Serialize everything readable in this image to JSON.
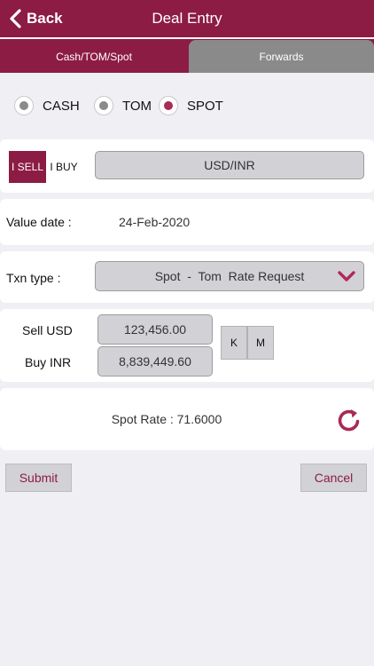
{
  "navbar": {
    "back_label": "Back",
    "title": "Deal Entry"
  },
  "tabs": {
    "cash_tom_spot": "Cash/TOM/Spot",
    "forwards": "Forwards"
  },
  "settlement": {
    "options": [
      {
        "label": "CASH",
        "selected": false
      },
      {
        "label": "TOM",
        "selected": false
      },
      {
        "label": "SPOT",
        "selected": true
      }
    ]
  },
  "deal": {
    "sell_label": "I SELL",
    "buy_label": "I BUY",
    "currency_pair": "USD/INR"
  },
  "value_date": {
    "label": "Value date :",
    "value": "24-Feb-2020"
  },
  "txn_type": {
    "label": "Txn type :",
    "value": "Spot  -  Tom  Rate Request"
  },
  "amounts": {
    "sell_label": "Sell USD",
    "sell_value": "123,456.00",
    "buy_label": "Buy INR",
    "buy_value": "8,839,449.60",
    "k_label": "K",
    "m_label": "M"
  },
  "rate": {
    "text": "Spot Rate : 71.6000"
  },
  "actions": {
    "submit_label": "Submit",
    "cancel_label": "Cancel"
  },
  "colors": {
    "brand": "#8c1c44",
    "accent": "#a82a55",
    "field": "#d2d2d6",
    "background": "#efeff4"
  }
}
